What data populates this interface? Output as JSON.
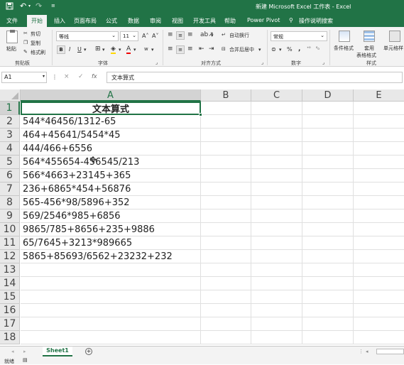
{
  "titlebar": {
    "title": "新建 Microsoft Excel 工作表 - Excel",
    "save_icon": "save-icon",
    "undo_icon": "undo-icon",
    "redo_icon": "redo-icon",
    "customize_icon": "customize-icon"
  },
  "tabs": [
    "文件",
    "开始",
    "插入",
    "页面布局",
    "公式",
    "数据",
    "审阅",
    "视图",
    "开发工具",
    "帮助",
    "Power Pivot"
  ],
  "active_tab": "开始",
  "tell_me": "操作说明搜索",
  "ribbon": {
    "clipboard": {
      "paste": "粘贴",
      "cut": "剪切",
      "copy": "复制",
      "format_painter": "格式刷",
      "group": "剪贴板"
    },
    "font": {
      "name": "等线",
      "size": "11",
      "bold": "B",
      "italic": "I",
      "underline": "U",
      "grow": "A˄",
      "shrink": "A˅",
      "group": "字体"
    },
    "alignment": {
      "wrap": "自动换行",
      "merge": "合并后居中",
      "group": "对齐方式"
    },
    "number": {
      "format": "常规",
      "percent": "%",
      "comma": ",",
      "group": "数字"
    },
    "styles": {
      "conditional": "条件格式",
      "table": "套用\n表格格式",
      "cell": "单元格样",
      "group": "样式"
    }
  },
  "formula_bar": {
    "name_box": "A1",
    "cancel": "×",
    "enter": "✓",
    "fx": "fx",
    "content": "文本算式"
  },
  "columns": [
    "A",
    "B",
    "C",
    "D",
    "E"
  ],
  "rows": [
    {
      "n": "1",
      "a": "文本算式"
    },
    {
      "n": "2",
      "a": "544*46456/1312-65"
    },
    {
      "n": "3",
      "a": "464+45641/5454*45"
    },
    {
      "n": "4",
      "a": "444/466+6556"
    },
    {
      "n": "5",
      "a": "564*455654-456545/213"
    },
    {
      "n": "6",
      "a": "566*4663+23145+365"
    },
    {
      "n": "7",
      "a": "236+6865*454+56876"
    },
    {
      "n": "8",
      "a": "565-456*98/5896+352"
    },
    {
      "n": "9",
      "a": "569/2546*985+6856"
    },
    {
      "n": "10",
      "a": "9865/785+8656+235+9886"
    },
    {
      "n": "11",
      "a": "65/7645+3213*989665"
    },
    {
      "n": "12",
      "a": "5865+85693/6562+23232+232"
    },
    {
      "n": "13",
      "a": ""
    },
    {
      "n": "14",
      "a": ""
    },
    {
      "n": "15",
      "a": ""
    },
    {
      "n": "16",
      "a": ""
    },
    {
      "n": "17",
      "a": ""
    },
    {
      "n": "18",
      "a": ""
    }
  ],
  "sheet": {
    "tab": "Sheet1",
    "add": "+"
  },
  "status": {
    "ready": "就绪"
  },
  "colors": {
    "accent": "#217346"
  }
}
